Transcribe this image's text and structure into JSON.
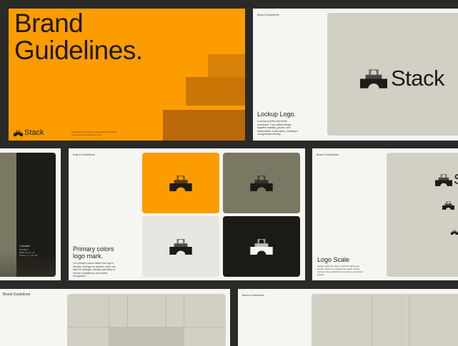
{
  "cover": {
    "title_line1": "Brand",
    "title_line2": "Guidelines.",
    "logo_text": "Stack",
    "tagline": "Designing and crafting exceptional architectural solutions built for lasting impact.",
    "color": "#fd9c00"
  },
  "lockup": {
    "header": "Brand Guidelines",
    "title": "Lockup Logo.",
    "body": "A strong symbol and sleek wordmark. This unified design signifies stability, growth, and dependable construction, creating a recognizable identity.",
    "logo_text": "Stack"
  },
  "palette": {
    "swatch_name": "Tuxback",
    "values": [
      "#1C1B17",
      "RGB: 28, 27, 23",
      "CMYK: 0, 4, 18, 89"
    ]
  },
  "primary": {
    "header": "Brand Guidelines",
    "title_line1": "Primary colors",
    "title_line2": "logo mark.",
    "body": "Our primary colors define the logo's identity: Orange for warmth, olive and dark for strength. Always pair them to ensure consistency and brand recognition.",
    "colors": [
      "#fd9c00",
      "#7a7863",
      "#e7e6e1",
      "#1c1b17"
    ]
  },
  "scale": {
    "header": "Brand Guidelines",
    "title": "Logo Scale",
    "body": "Always scale the logo to maintain clarity and impact. Never too small to lose detail. Follow minimum size guidelines for a strong, consistent identity.",
    "logo_text": "S"
  },
  "bottom": {
    "header_left": "Brand Guidelines",
    "header_right": "Brand Guidelines"
  }
}
